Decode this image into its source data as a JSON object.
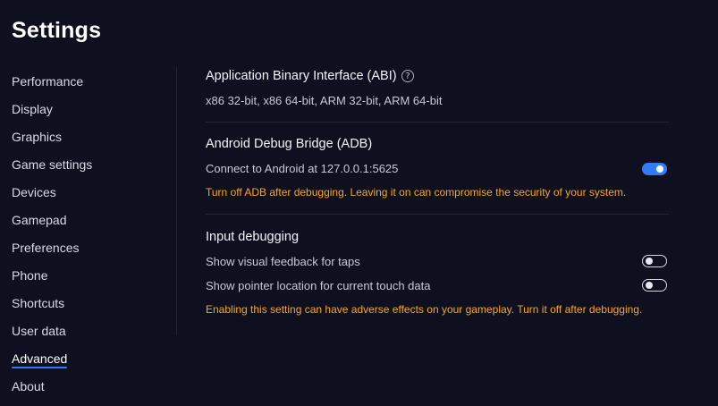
{
  "page": {
    "title": "Settings"
  },
  "sidebar": {
    "items": [
      {
        "label": "Performance"
      },
      {
        "label": "Display"
      },
      {
        "label": "Graphics"
      },
      {
        "label": "Game settings"
      },
      {
        "label": "Devices"
      },
      {
        "label": "Gamepad"
      },
      {
        "label": "Preferences"
      },
      {
        "label": "Phone"
      },
      {
        "label": "Shortcuts"
      },
      {
        "label": "User data"
      },
      {
        "label": "Advanced"
      },
      {
        "label": "About"
      }
    ],
    "active": "Advanced"
  },
  "abi": {
    "title": "Application Binary Interface (ABI)",
    "help_icon": "question-mark-icon",
    "value": "x86 32-bit, x86 64-bit, ARM 32-bit, ARM 64-bit"
  },
  "adb": {
    "title": "Android Debug Bridge (ADB)",
    "connect_label": "Connect to Android at 127.0.0.1:5625",
    "connect_enabled": true,
    "warning": "Turn off ADB after debugging. Leaving it on can compromise the security of your system."
  },
  "input_debugging": {
    "title": "Input debugging",
    "taps_label": "Show visual feedback for taps",
    "taps_enabled": false,
    "pointer_label": "Show pointer location for current touch data",
    "pointer_enabled": false,
    "warning": "Enabling this setting can have adverse effects on your gameplay. Turn it off after debugging."
  },
  "colors": {
    "background": "#0e1020",
    "accent": "#2f7cf6",
    "warning": "#f6a623"
  }
}
